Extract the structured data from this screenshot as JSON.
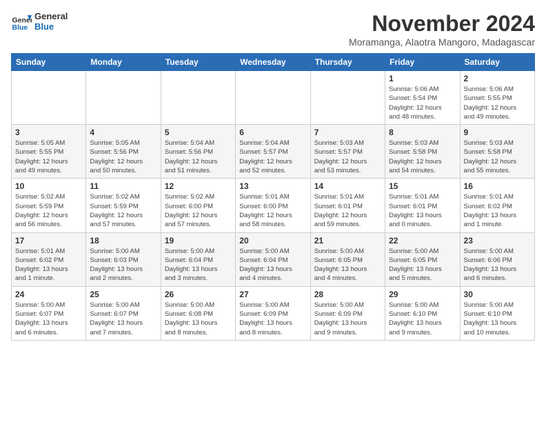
{
  "logo": {
    "line1": "General",
    "line2": "Blue"
  },
  "title": "November 2024",
  "subtitle": "Moramanga, Alaotra Mangoro, Madagascar",
  "weekdays": [
    "Sunday",
    "Monday",
    "Tuesday",
    "Wednesday",
    "Thursday",
    "Friday",
    "Saturday"
  ],
  "weeks": [
    [
      {
        "day": "",
        "info": ""
      },
      {
        "day": "",
        "info": ""
      },
      {
        "day": "",
        "info": ""
      },
      {
        "day": "",
        "info": ""
      },
      {
        "day": "",
        "info": ""
      },
      {
        "day": "1",
        "info": "Sunrise: 5:06 AM\nSunset: 5:54 PM\nDaylight: 12 hours\nand 48 minutes."
      },
      {
        "day": "2",
        "info": "Sunrise: 5:06 AM\nSunset: 5:55 PM\nDaylight: 12 hours\nand 49 minutes."
      }
    ],
    [
      {
        "day": "3",
        "info": "Sunrise: 5:05 AM\nSunset: 5:55 PM\nDaylight: 12 hours\nand 49 minutes."
      },
      {
        "day": "4",
        "info": "Sunrise: 5:05 AM\nSunset: 5:56 PM\nDaylight: 12 hours\nand 50 minutes."
      },
      {
        "day": "5",
        "info": "Sunrise: 5:04 AM\nSunset: 5:56 PM\nDaylight: 12 hours\nand 51 minutes."
      },
      {
        "day": "6",
        "info": "Sunrise: 5:04 AM\nSunset: 5:57 PM\nDaylight: 12 hours\nand 52 minutes."
      },
      {
        "day": "7",
        "info": "Sunrise: 5:03 AM\nSunset: 5:57 PM\nDaylight: 12 hours\nand 53 minutes."
      },
      {
        "day": "8",
        "info": "Sunrise: 5:03 AM\nSunset: 5:58 PM\nDaylight: 12 hours\nand 54 minutes."
      },
      {
        "day": "9",
        "info": "Sunrise: 5:03 AM\nSunset: 5:58 PM\nDaylight: 12 hours\nand 55 minutes."
      }
    ],
    [
      {
        "day": "10",
        "info": "Sunrise: 5:02 AM\nSunset: 5:59 PM\nDaylight: 12 hours\nand 56 minutes."
      },
      {
        "day": "11",
        "info": "Sunrise: 5:02 AM\nSunset: 5:59 PM\nDaylight: 12 hours\nand 57 minutes."
      },
      {
        "day": "12",
        "info": "Sunrise: 5:02 AM\nSunset: 6:00 PM\nDaylight: 12 hours\nand 57 minutes."
      },
      {
        "day": "13",
        "info": "Sunrise: 5:01 AM\nSunset: 6:00 PM\nDaylight: 12 hours\nand 58 minutes."
      },
      {
        "day": "14",
        "info": "Sunrise: 5:01 AM\nSunset: 6:01 PM\nDaylight: 12 hours\nand 59 minutes."
      },
      {
        "day": "15",
        "info": "Sunrise: 5:01 AM\nSunset: 6:01 PM\nDaylight: 13 hours\nand 0 minutes."
      },
      {
        "day": "16",
        "info": "Sunrise: 5:01 AM\nSunset: 6:02 PM\nDaylight: 13 hours\nand 1 minute."
      }
    ],
    [
      {
        "day": "17",
        "info": "Sunrise: 5:01 AM\nSunset: 6:02 PM\nDaylight: 13 hours\nand 1 minute."
      },
      {
        "day": "18",
        "info": "Sunrise: 5:00 AM\nSunset: 6:03 PM\nDaylight: 13 hours\nand 2 minutes."
      },
      {
        "day": "19",
        "info": "Sunrise: 5:00 AM\nSunset: 6:04 PM\nDaylight: 13 hours\nand 3 minutes."
      },
      {
        "day": "20",
        "info": "Sunrise: 5:00 AM\nSunset: 6:04 PM\nDaylight: 13 hours\nand 4 minutes."
      },
      {
        "day": "21",
        "info": "Sunrise: 5:00 AM\nSunset: 6:05 PM\nDaylight: 13 hours\nand 4 minutes."
      },
      {
        "day": "22",
        "info": "Sunrise: 5:00 AM\nSunset: 6:05 PM\nDaylight: 13 hours\nand 5 minutes."
      },
      {
        "day": "23",
        "info": "Sunrise: 5:00 AM\nSunset: 6:06 PM\nDaylight: 13 hours\nand 6 minutes."
      }
    ],
    [
      {
        "day": "24",
        "info": "Sunrise: 5:00 AM\nSunset: 6:07 PM\nDaylight: 13 hours\nand 6 minutes."
      },
      {
        "day": "25",
        "info": "Sunrise: 5:00 AM\nSunset: 6:07 PM\nDaylight: 13 hours\nand 7 minutes."
      },
      {
        "day": "26",
        "info": "Sunrise: 5:00 AM\nSunset: 6:08 PM\nDaylight: 13 hours\nand 8 minutes."
      },
      {
        "day": "27",
        "info": "Sunrise: 5:00 AM\nSunset: 6:09 PM\nDaylight: 13 hours\nand 8 minutes."
      },
      {
        "day": "28",
        "info": "Sunrise: 5:00 AM\nSunset: 6:09 PM\nDaylight: 13 hours\nand 9 minutes."
      },
      {
        "day": "29",
        "info": "Sunrise: 5:00 AM\nSunset: 6:10 PM\nDaylight: 13 hours\nand 9 minutes."
      },
      {
        "day": "30",
        "info": "Sunrise: 5:00 AM\nSunset: 6:10 PM\nDaylight: 13 hours\nand 10 minutes."
      }
    ]
  ]
}
